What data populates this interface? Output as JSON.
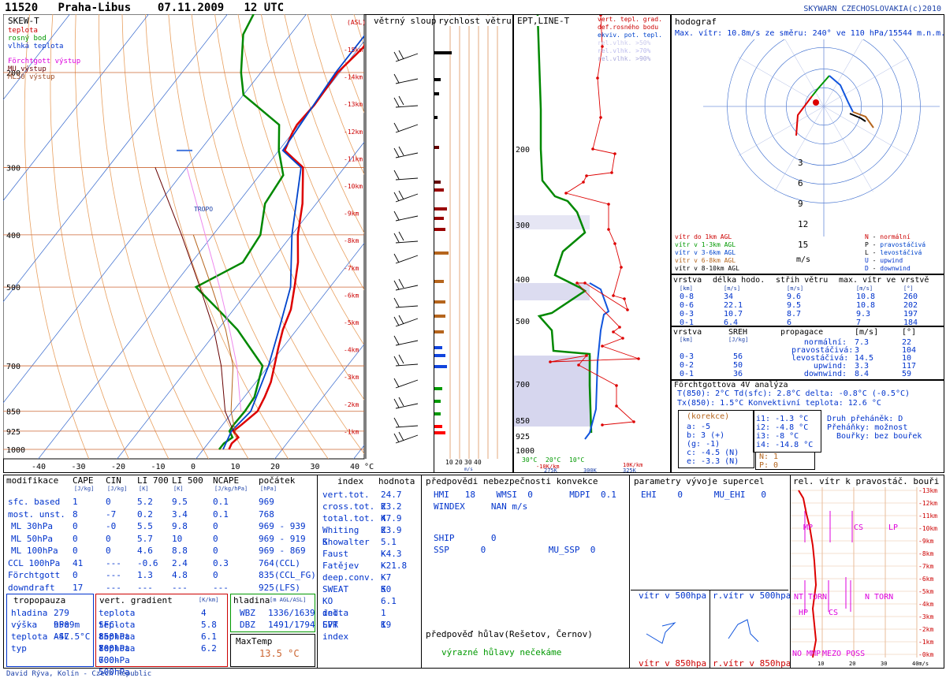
{
  "header": {
    "station": "11520",
    "place": "Praha-Libus",
    "date": "07.11.2009",
    "time": "12 UTC",
    "copyright": "SKYWARN CZECHOSLOVAKIA(c)2010"
  },
  "footer": "David Rýva, Kolín - Czech Republic",
  "skewt": {
    "title": "SKEW-T",
    "legend": [
      {
        "label": "teplota",
        "color": "#dd0000"
      },
      {
        "label": "rosný bod",
        "color": "#009900"
      },
      {
        "label": "vlhká teplota",
        "color": "#0044cc"
      },
      {
        "label": "Förchtgott výstup",
        "color": "#dd00dd"
      },
      {
        "label": "MU výstup",
        "color": "#660000"
      },
      {
        "label": "ML50 výstup",
        "color": "#b5651d"
      }
    ],
    "asl_label": "(ASL)",
    "tropo_label": "TROPO",
    "pressure_ticks": [
      200,
      300,
      400,
      500,
      700,
      850,
      925,
      1000
    ],
    "height_labels": [
      "-15km",
      "-14km",
      "-13km",
      "-12km",
      "-11km",
      "-10km",
      "-9km",
      "-8km",
      "-7km",
      "-6km",
      "-5km",
      "-4km",
      "-3km",
      "-2km",
      "-1km"
    ],
    "temp_ticks": [
      "-40",
      "-30",
      "-20",
      "-10",
      "0",
      "10",
      "20",
      "30",
      "40 °C"
    ]
  },
  "chart_data": {
    "type": "line",
    "title": "",
    "xlabel": "",
    "ylabel": "",
    "xlim": [
      -40,
      40
    ],
    "ylim": [
      1000,
      100
    ],
    "series": [
      {
        "name": "teplota",
        "points": [
          [
            1000,
            6.5
          ],
          [
            975,
            6
          ],
          [
            950,
            6.5
          ],
          [
            925,
            4
          ],
          [
            900,
            4.8
          ],
          [
            850,
            6.2
          ],
          [
            800,
            5.2
          ],
          [
            750,
            3.8
          ],
          [
            700,
            1.5
          ],
          [
            650,
            -1
          ],
          [
            600,
            -3.5
          ],
          [
            550,
            -5.5
          ],
          [
            500,
            -9
          ],
          [
            450,
            -13
          ],
          [
            400,
            -18.5
          ],
          [
            350,
            -23.5
          ],
          [
            300,
            -30.5
          ],
          [
            279,
            -38.5
          ],
          [
            260,
            -40
          ],
          [
            250,
            -40.5
          ],
          [
            230,
            -40
          ],
          [
            200,
            -40.5
          ],
          [
            180,
            -39
          ],
          [
            150,
            -40
          ],
          [
            120,
            -41
          ],
          [
            100,
            -42
          ]
        ]
      },
      {
        "name": "rosný bod",
        "points": [
          [
            1000,
            4
          ],
          [
            975,
            4
          ],
          [
            950,
            5
          ],
          [
            925,
            3
          ],
          [
            900,
            2.8
          ],
          [
            850,
            3
          ],
          [
            800,
            2.6
          ],
          [
            700,
            -1.5
          ],
          [
            650,
            -8
          ],
          [
            600,
            -15
          ],
          [
            550,
            -24
          ],
          [
            500,
            -34
          ],
          [
            450,
            -27
          ],
          [
            400,
            -28
          ],
          [
            350,
            -33
          ],
          [
            310,
            -34
          ],
          [
            279,
            -40
          ],
          [
            250,
            -45
          ],
          [
            220,
            -60
          ],
          [
            200,
            -65
          ],
          [
            170,
            -72
          ],
          [
            150,
            -74
          ],
          [
            120,
            -80
          ],
          [
            100,
            -85
          ]
        ]
      },
      {
        "name": "vlhká teplota",
        "points": [
          [
            1000,
            5
          ],
          [
            925,
            3.5
          ],
          [
            850,
            4.5
          ],
          [
            700,
            0
          ],
          [
            600,
            -4.5
          ],
          [
            500,
            -10
          ],
          [
            400,
            -20
          ],
          [
            300,
            -31
          ],
          [
            279,
            -39
          ],
          [
            200,
            -41
          ],
          [
            150,
            -41
          ],
          [
            100,
            -42.5
          ]
        ]
      },
      {
        "name": "Förchtgott výstup",
        "points": [
          [
            850,
            2
          ],
          [
            700,
            -8
          ],
          [
            600,
            -17
          ],
          [
            500,
            -28
          ],
          [
            400,
            -42
          ],
          [
            300,
            -60
          ]
        ]
      },
      {
        "name": "MU výstup",
        "points": [
          [
            925,
            4
          ],
          [
            850,
            -2
          ],
          [
            700,
            -12
          ],
          [
            600,
            -21
          ],
          [
            500,
            -33
          ],
          [
            400,
            -48
          ],
          [
            300,
            -68
          ]
        ]
      },
      {
        "name": "ML50 výstup",
        "points": [
          [
            950,
            6
          ],
          [
            850,
            -0.5
          ],
          [
            700,
            -9
          ],
          [
            600,
            -18
          ],
          [
            500,
            -30
          ],
          [
            400,
            -45
          ]
        ]
      }
    ],
    "isotherm_0": 0,
    "wind_profile": {
      "title": "větrný sloup"
    },
    "wind_speed": {
      "title": "rychlost větru",
      "xticks": [
        "10",
        "20",
        "30",
        "40"
      ],
      "unit": "m/s"
    },
    "ept": {
      "title": "EPT,LINE-T",
      "xticks": [
        "30°C",
        "20°C",
        "10°C"
      ],
      "bottom_labels": [
        "275K",
        "300K",
        "325K"
      ],
      "km_labels": [
        "-10K/km",
        "10K/km"
      ],
      "legend": [
        {
          "label": "vert. tepl. grad.",
          "color": "#cc0000"
        },
        {
          "label": "def.rosného bodu",
          "color": "#009900"
        },
        {
          "label": "ekviv. pot. tepl.",
          "color": "#0044cc"
        },
        {
          "label": "rel.vlhk. >50%",
          "color": "#ccccee"
        },
        {
          "label": "rel.vlhk. >70%",
          "color": "#bbbbee"
        },
        {
          "label": "rel.vlhk. >90%",
          "color": "#aaaadd"
        }
      ]
    }
  },
  "hodograph": {
    "title": "hodograf",
    "maxwind": "Max. vítr: 10.8m/s ze směru: 240° ve 110 hPa/15544 m.n.m.",
    "rings": [
      "3",
      "6",
      "9",
      "12",
      "15"
    ],
    "unit": "m/s",
    "legend_left": [
      {
        "label": "vítr do 1km AGL",
        "color": "#cc0000"
      },
      {
        "label": "vítr v 1-3km AGL",
        "color": "#009900"
      },
      {
        "label": "vítr v 3-6km AGL",
        "color": "#0044cc"
      },
      {
        "label": "vítr v 6-8km AGL",
        "color": "#b5651d"
      },
      {
        "label": "vítr v 8-10km AGL",
        "color": "#000000"
      }
    ],
    "legend_right": [
      {
        "key": "N",
        "label": "normální",
        "color": "#cc0000"
      },
      {
        "key": "P",
        "label": "pravostáčivá",
        "color": "#000000"
      },
      {
        "key": "L",
        "label": "levostáčivá",
        "color": "#000000"
      },
      {
        "key": "U",
        "label": "upwind",
        "color": "#0044cc"
      },
      {
        "key": "D",
        "label": "downwind",
        "color": "#0044cc"
      }
    ]
  },
  "shear": {
    "head": [
      "vrstva",
      "délka hodo.",
      "střih větru",
      "max. vítr ve vrstvě"
    ],
    "units": [
      "[km]",
      "[m/s]",
      "[m/s]",
      "[m/s]",
      "[°]"
    ],
    "rows": [
      [
        "0-8",
        "34",
        "9.6",
        "10.8",
        "260"
      ],
      [
        "0-6",
        "22.1",
        "9.5",
        "10.8",
        "202"
      ],
      [
        "0-3",
        "10.7",
        "8.7",
        "9.3",
        "197"
      ],
      [
        "0-1",
        "6.4",
        "6",
        "7",
        "184"
      ]
    ]
  },
  "sreh": {
    "head": [
      "vrstva",
      "SREH",
      "propagace",
      "[m/s]",
      "[°]"
    ],
    "units": [
      "[km]",
      "[J/kg]"
    ],
    "rows": [
      [
        "0-3",
        "56"
      ],
      [
        "0-2",
        "50"
      ],
      [
        "0-1",
        "36"
      ]
    ],
    "prop": [
      [
        "normální:",
        "7.3",
        "22"
      ],
      [
        "pravostáčivá:",
        "3",
        "104"
      ],
      [
        "levostáčivá:",
        "14.5",
        "10"
      ],
      [
        "upwind:",
        "3.3",
        "117"
      ],
      [
        "downwind:",
        "8.4",
        "59"
      ]
    ]
  },
  "forchtgott": {
    "title": "Förchtgottova 4V analýza",
    "line1": "T(850): 2°C  Td(sfc): 2.8°C  delta: -0.8°C (-0.5°C)",
    "line2": "Tx(850): 1.5°C    Konvektivní teplota: 12.6 °C",
    "korekce": "(korekce)",
    "left": [
      "a: -5",
      "b: 3 (+)",
      "(g: -1)",
      "c: -4.5 (N)",
      "e: -3.3 (N)"
    ],
    "mid": [
      "i1: -1.3 °C",
      "i2: -4.8 °C",
      "i3: -8 °C",
      "i4: -14.8 °C"
    ],
    "right": [
      "Druh přeháněk: D",
      "Přeháňky: možnost",
      "Bouřky: bez bouřek"
    ],
    "np": [
      "N: 1",
      "P: 0"
    ]
  },
  "mods": {
    "head": [
      "modifikace",
      "CAPE",
      "CIN",
      "LI 700",
      "LI 500",
      "NCAPE",
      "počátek"
    ],
    "units": [
      "",
      "[J/kg]",
      "[J/kg]",
      "[K]",
      "[K]",
      "[J/kg/hPa]",
      "[hPa]"
    ],
    "rows": [
      [
        "sfc. based",
        "1",
        "0",
        "5.2",
        "9.5",
        "0.1",
        "969"
      ],
      [
        "most. unst.",
        "8",
        "-7",
        "0.2",
        "3.4",
        "0.1",
        "768"
      ],
      [
        "ML 30hPa",
        "0",
        "-0",
        "5.5",
        "9.8",
        "0",
        "969 - 939"
      ],
      [
        "ML 50hPa",
        "0",
        "0",
        "5.7",
        "10",
        "0",
        "969 - 919"
      ],
      [
        "ML 100hPa",
        "0",
        "0",
        "4.6",
        "8.8",
        "0",
        "969 - 869"
      ],
      [
        "CCL 100hPa",
        "41",
        "---",
        "-0.6",
        "2.4",
        "0.3",
        "764(CCL)"
      ],
      [
        "Förchtgott",
        "0",
        "---",
        "1.3",
        "4.8",
        "0",
        "835(CCL_FG)"
      ],
      [
        "downdraft",
        "17",
        "---",
        "---",
        "---",
        "---",
        "925(LFS)"
      ]
    ]
  },
  "tropo": {
    "title": "tropopauza",
    "rows": [
      [
        "hladina",
        "279 hPa"
      ],
      [
        "výška",
        "9509m ASL"
      ],
      [
        "teplota",
        "-47.5°C"
      ],
      [
        "typ",
        ""
      ]
    ]
  },
  "gradient": {
    "title": "vert. gradient",
    "unit": "[K/km]",
    "rows": [
      [
        "teplota SFC-850hPa",
        "4"
      ],
      [
        "teplota 850-700hPa",
        "5.8"
      ],
      [
        "teplota 800-600hPa",
        "6.1"
      ],
      [
        "teplota 700-500hPa",
        "6.2"
      ]
    ]
  },
  "hladina": {
    "title": "hladina",
    "unit": "[m AGL/ASL]",
    "rows": [
      [
        "WBZ",
        "1336/1639"
      ],
      [
        "DBZ",
        "1491/1794"
      ]
    ]
  },
  "maxtemp": {
    "title": "MaxTemp",
    "value": "13.5 °C"
  },
  "indexes": {
    "head": [
      "index",
      "hodnota"
    ],
    "rows": [
      [
        "vert.tot.",
        "24.7 K"
      ],
      [
        "cross.tot.",
        "23.2 K"
      ],
      [
        "total.tot.",
        "47.9 K"
      ],
      [
        "Whiting K",
        "23.9"
      ],
      [
        "Showalter",
        "5.1 K"
      ],
      [
        "Faust",
        "-4.3 K"
      ],
      [
        "Fatějev",
        "-21.8 K"
      ],
      [
        "deep.conv.",
        "-7 K"
      ],
      [
        "SWEAT",
        "50"
      ],
      [
        "KO ind.",
        "6.1"
      ],
      [
        "delta EPT",
        "1 K"
      ],
      [
        "SVR index",
        "19"
      ]
    ]
  },
  "forecast": {
    "title": "předpovědi nebezpečnosti konvekce",
    "hmi": "HMI",
    "hmi_v": "18",
    "wmsi": "WMSI",
    "wmsi_v": "0",
    "mdpi": "MDPI",
    "mdpi_v": "0.1",
    "windex": "WINDEX",
    "windex_v": "NAN m/s",
    "ship": "SHIP",
    "ship_v": "0",
    "ssp": "SSP",
    "ssp_v": "0",
    "musp": "MU_SSP",
    "musp_v": "0",
    "hail_title": "předpověď hůlav(Rešetov, Černov)",
    "hail_text": "výrazné hůlavy nečekáme"
  },
  "supercell": {
    "title": "parametry vývoje supercel",
    "ehi": "EHI",
    "ehi_v": "0",
    "muehi": "MU_EHI",
    "muehi_v": "0",
    "w500": "vítr v 500hpa",
    "rw500": "r.vítr v 500hpa",
    "w850": "vítr v 850hpa",
    "rw850": "r.vítr v 850hpa"
  },
  "relwind": {
    "title": "rel. vítr k pravostáč. bouři",
    "km": [
      "-13km",
      "-12km",
      "-11km",
      "-10km",
      "-9km",
      "-8km",
      "-7km",
      "-6km",
      "-5km",
      "-4km",
      "-3km",
      "-2km",
      "-1km",
      "-0km"
    ],
    "xt": [
      "10",
      "20",
      "30",
      "40m/s"
    ],
    "labels": {
      "mp": "MP",
      "cs": "CS",
      "lp": "LP",
      "nt": "NT",
      "torn": "TORN",
      "ntorn": "N TORN",
      "hp": "HP",
      "cs2": "CS",
      "nom": "NO M",
      "mp2": "MP",
      "mezo": "MEZO POSS"
    }
  }
}
